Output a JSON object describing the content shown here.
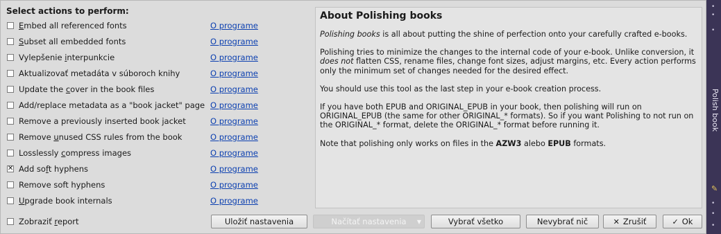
{
  "heading": "Select actions to perform:",
  "link_label": "O programe",
  "actions": [
    {
      "pre": "",
      "u": "E",
      "post": "mbed all referenced fonts",
      "checked": false
    },
    {
      "pre": "",
      "u": "S",
      "post": "ubset all embedded fonts",
      "checked": false
    },
    {
      "pre": "Vylepšenie ",
      "u": "i",
      "post": "nterpunkcie",
      "checked": false
    },
    {
      "pre": "Aktualizovať metadáta v súboroch knihy",
      "u": "",
      "post": "",
      "checked": false
    },
    {
      "pre": "Update the ",
      "u": "c",
      "post": "over in the book files",
      "checked": false
    },
    {
      "pre": "Add/replace metadata as a \"book ",
      "u": "j",
      "post": "acket\" page",
      "checked": false
    },
    {
      "pre": "Remove a previously inserted book jacket",
      "u": "",
      "post": "",
      "checked": false
    },
    {
      "pre": "Remove ",
      "u": "u",
      "post": "nused CSS rules from the book",
      "checked": false
    },
    {
      "pre": "Losslessly ",
      "u": "c",
      "post": "ompress images",
      "checked": false
    },
    {
      "pre": "Add so",
      "u": "f",
      "post": "t hyphens",
      "checked": true
    },
    {
      "pre": "Remove soft hyphens",
      "u": "",
      "post": "",
      "checked": false
    },
    {
      "pre": "",
      "u": "U",
      "post": "pgrade book internals",
      "checked": false
    }
  ],
  "show_report": {
    "pre": "Zobraziť ",
    "u": "r",
    "post": "eport",
    "checked": false
  },
  "about": {
    "title": "About Polishing books",
    "p1_em": "Polishing books",
    "p1_rest": " is all about putting the shine of perfection onto your carefully crafted e-books.",
    "p2_a": "Polishing tries to minimize the changes to the internal code of your e-book. Unlike conversion, it ",
    "p2_em": "does not",
    "p2_b": " flatten CSS, rename files, change font sizes, adjust margins, etc. Every action performs only the minimum set of changes needed for the desired effect.",
    "p3": "You should use this tool as the last step in your e-book creation process.",
    "p4": "If you have both EPUB and ORIGINAL_EPUB in your book, then polishing will run on ORIGINAL_EPUB (the same for other ORIGINAL_* formats). So if you want Polishing to not run on the ORIGINAL_* format, delete the ORIGINAL_* format before running it.",
    "p5_a": "Note that polishing only works on files in the ",
    "p5_b1": "AZW3",
    "p5_mid": " alebo ",
    "p5_b2": "EPUB",
    "p5_end": " formats."
  },
  "buttons": {
    "save": "Uložiť nastavenia",
    "load": "Načítať nastavenia",
    "select_all": "Vybrať všetko",
    "select_none": "Nevybrať nič",
    "cancel": "Zrušiť",
    "ok": "Ok"
  },
  "sidebar": {
    "label": "Polish book"
  }
}
